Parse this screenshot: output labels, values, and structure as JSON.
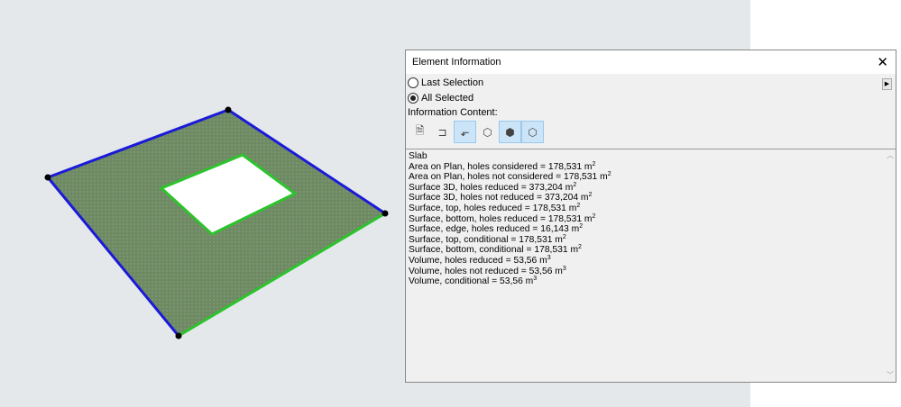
{
  "dialog": {
    "title": "Element Information",
    "radios": [
      {
        "label": "Last Selection",
        "checked": false
      },
      {
        "label": "All Selected",
        "checked": true
      }
    ],
    "info_content_label": "Information Content:",
    "icons": [
      {
        "name": "document-icon",
        "selected": false,
        "glyph": "🗎"
      },
      {
        "name": "plan-element-icon",
        "selected": false,
        "glyph": "⊐"
      },
      {
        "name": "plan-area-icon",
        "selected": true,
        "glyph": "⬐"
      },
      {
        "name": "3d-box-icon",
        "selected": false,
        "glyph": "⬡"
      },
      {
        "name": "3d-surface-icon",
        "selected": true,
        "glyph": "⬢"
      },
      {
        "name": "3d-volume-icon",
        "selected": true,
        "glyph": "⬡"
      }
    ],
    "lines": [
      {
        "text": "Slab",
        "unit": ""
      },
      {
        "text": "Area on Plan, holes considered = 178,531 m",
        "unit": "2"
      },
      {
        "text": "Area on Plan, holes not considered = 178,531 m",
        "unit": "2"
      },
      {
        "text": "Surface 3D, holes reduced = 373,204 m",
        "unit": "2"
      },
      {
        "text": "Surface 3D, holes not reduced = 373,204 m",
        "unit": "2"
      },
      {
        "text": "Surface, top, holes reduced = 178,531 m",
        "unit": "2"
      },
      {
        "text": "Surface, bottom, holes reduced = 178,531 m",
        "unit": "2"
      },
      {
        "text": "Surface, edge, holes reduced = 16,143 m",
        "unit": "2"
      },
      {
        "text": "Surface, top, conditional = 178,531 m",
        "unit": "2"
      },
      {
        "text": "Surface, bottom, conditional = 178,531 m",
        "unit": "2"
      },
      {
        "text": "Volume, holes reduced = 53,56 m",
        "unit": "3"
      },
      {
        "text": "Volume, holes not reduced = 53,56 m",
        "unit": "3"
      },
      {
        "text": "Volume, conditional = 53,56 m",
        "unit": "3"
      }
    ]
  },
  "colors": {
    "slab": "#6e8a63",
    "selected_edge": "#1a1ad8",
    "hole_edge": "#2cc42c"
  }
}
